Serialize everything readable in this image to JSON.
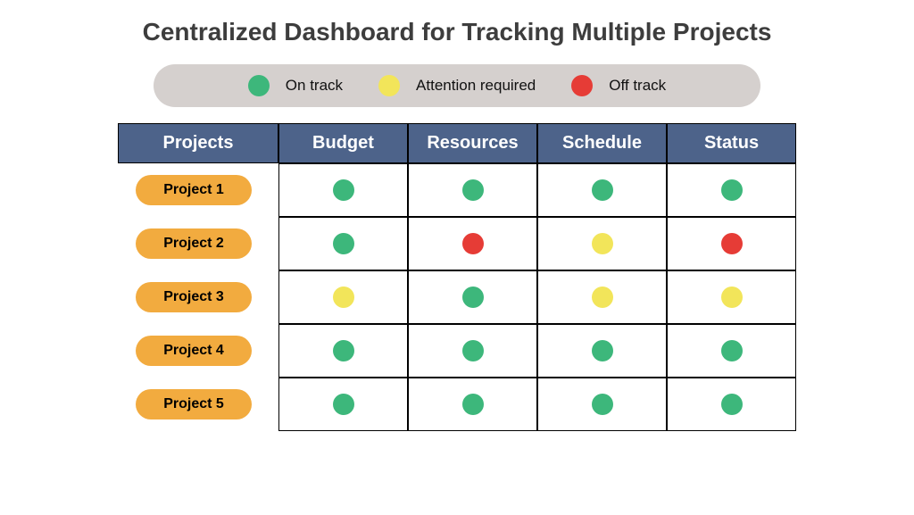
{
  "title": "Centralized Dashboard for Tracking Multiple Projects",
  "legend": {
    "on_track": "On track",
    "attention": "Attention required",
    "off_track": "Off track"
  },
  "columns": [
    "Projects",
    "Budget",
    "Resources",
    "Schedule",
    "Status"
  ],
  "status_colors": {
    "green": "#3db77b",
    "yellow": "#f2e55a",
    "red": "#e63c36"
  },
  "projects": [
    {
      "name": "Project 1",
      "budget": "green",
      "resources": "green",
      "schedule": "green",
      "status": "green"
    },
    {
      "name": "Project 2",
      "budget": "green",
      "resources": "red",
      "schedule": "yellow",
      "status": "red"
    },
    {
      "name": "Project 3",
      "budget": "yellow",
      "resources": "green",
      "schedule": "yellow",
      "status": "yellow"
    },
    {
      "name": "Project 4",
      "budget": "green",
      "resources": "green",
      "schedule": "green",
      "status": "green"
    },
    {
      "name": "Project 5",
      "budget": "green",
      "resources": "green",
      "schedule": "green",
      "status": "green"
    }
  ]
}
